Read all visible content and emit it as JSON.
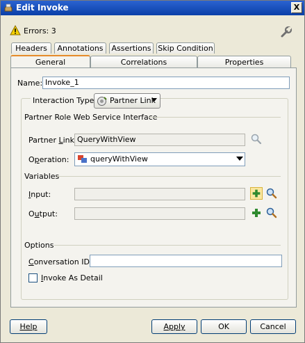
{
  "window": {
    "title": "Edit Invoke",
    "close_label": "X"
  },
  "status": {
    "errors_text": "Errors: 3"
  },
  "tabs_row1": [
    {
      "label": "Headers"
    },
    {
      "label": "Annotations"
    },
    {
      "label": "Assertions"
    },
    {
      "label": "Skip Condition"
    }
  ],
  "tabs_row2": [
    {
      "label": "General",
      "active": true
    },
    {
      "label": "Correlations"
    },
    {
      "label": "Properties"
    }
  ],
  "general": {
    "name_label": "Name:",
    "name_value": "Invoke_1",
    "interaction_label": "Interaction Type:",
    "interaction_value": "Partner Link",
    "partner_section": "Partner Role Web Service Interface",
    "partner_link_label": "Partner Link:",
    "partner_link_value": "QueryWithView",
    "operation_label": "Operation:",
    "operation_value": "queryWithView",
    "variables_section": "Variables",
    "input_label": "Input:",
    "input_value": "",
    "output_label": "Output:",
    "output_value": "",
    "options_section": "Options",
    "conversation_label": "Conversation ID:",
    "conversation_value": "",
    "invoke_detail_label": "Invoke As Detail"
  },
  "buttons": {
    "help": "Help",
    "apply": "Apply",
    "ok": "OK",
    "cancel": "Cancel"
  },
  "icons": {
    "title": "app-icon",
    "warning": "warning-icon",
    "wrench": "wrench-icon",
    "search": "search-icon",
    "add": "add-icon",
    "operation": "operation-icon",
    "partner_link": "partner-link-icon"
  }
}
